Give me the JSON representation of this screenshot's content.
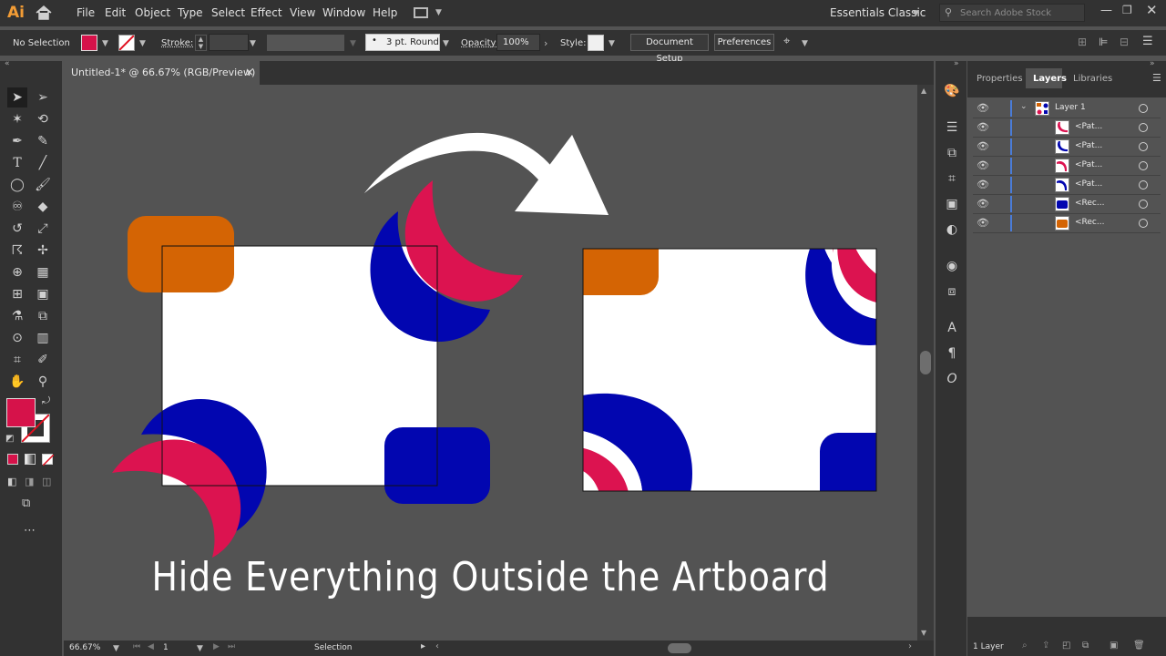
{
  "app": {
    "logo": "Ai",
    "home_icon": "home-icon"
  },
  "menu": [
    "File",
    "Edit",
    "Object",
    "Type",
    "Select",
    "Effect",
    "View",
    "Window",
    "Help"
  ],
  "workspace": "Essentials Classic",
  "search_placeholder": "Search Adobe Stock",
  "control": {
    "selection": "No Selection",
    "stroke_label": "Stroke:",
    "brush": "3 pt. Round",
    "opacity_label": "Opacity:",
    "opacity_value": "100%",
    "style_label": "Style:",
    "doc_setup": "Document Setup",
    "preferences": "Preferences"
  },
  "document": {
    "tab_title": "Untitled-1* @ 66.67% (RGB/Preview)",
    "close": "×"
  },
  "status": {
    "zoom": "66.67%",
    "artboard": "1",
    "tool": "Selection"
  },
  "panels": {
    "tabs": [
      "Properties",
      "Layers",
      "Libraries"
    ],
    "layers": [
      {
        "name": "Layer 1",
        "thumb": "layer"
      },
      {
        "name": "<Pat...",
        "thumb": "path-red-curve"
      },
      {
        "name": "<Pat...",
        "thumb": "path-blue-curve"
      },
      {
        "name": "<Pat...",
        "thumb": "path-red-curve"
      },
      {
        "name": "<Pat...",
        "thumb": "path-blue-curve"
      },
      {
        "name": "<Rec...",
        "thumb": "rect-blue"
      },
      {
        "name": "<Rec...",
        "thumb": "rect-orange"
      }
    ],
    "footer": "1 Layer"
  },
  "colors": {
    "fill": "#d6124a",
    "orange": "#d46404",
    "blue": "#0206b0",
    "crimson": "#dc1350",
    "canvas": "#535353"
  },
  "caption": "Hide Everything Outside the Artboard"
}
